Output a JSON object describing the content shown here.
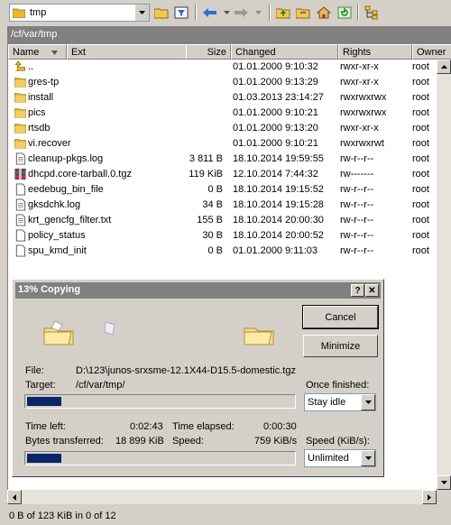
{
  "toolbar": {
    "location": "tmp"
  },
  "path": "/cf/var/tmp",
  "columns": {
    "name": "Name",
    "ext": "Ext",
    "size": "Size",
    "changed": "Changed",
    "rights": "Rights",
    "owner": "Owner"
  },
  "files": [
    {
      "name": "..",
      "size": "",
      "changed": "01.01.2000 9:10:32",
      "rights": "rwxr-xr-x",
      "owner": "root",
      "icon": "parent-dir-icon"
    },
    {
      "name": "gres-tp",
      "size": "",
      "changed": "01.01.2000 9:13:29",
      "rights": "rwxr-xr-x",
      "owner": "root",
      "icon": "folder-icon"
    },
    {
      "name": "install",
      "size": "",
      "changed": "01.03.2013 23:14:27",
      "rights": "rwxrwxrwx",
      "owner": "root",
      "icon": "folder-icon"
    },
    {
      "name": "pics",
      "size": "",
      "changed": "01.01.2000 9:10:21",
      "rights": "rwxrwxrwx",
      "owner": "root",
      "icon": "folder-icon"
    },
    {
      "name": "rtsdb",
      "size": "",
      "changed": "01.01.2000 9:13:20",
      "rights": "rwxr-xr-x",
      "owner": "root",
      "icon": "folder-icon"
    },
    {
      "name": "vi.recover",
      "size": "",
      "changed": "01.01.2000 9:10:21",
      "rights": "rwxrwxrwt",
      "owner": "root",
      "icon": "folder-icon"
    },
    {
      "name": "cleanup-pkgs.log",
      "size": "3 811 B",
      "changed": "18.10.2014 19:59:55",
      "rights": "rw-r--r--",
      "owner": "root",
      "icon": "text-file-icon"
    },
    {
      "name": "dhcpd.core-tarball.0.tgz",
      "size": "119 KiB",
      "changed": "12.10.2014 7:44:32",
      "rights": "rw-------",
      "owner": "root",
      "icon": "archive-file-icon"
    },
    {
      "name": "eedebug_bin_file",
      "size": "0 B",
      "changed": "18.10.2014 19:15:52",
      "rights": "rw-r--r--",
      "owner": "root",
      "icon": "file-icon"
    },
    {
      "name": "gksdchk.log",
      "size": "34 B",
      "changed": "18.10.2014 19:15:28",
      "rights": "rw-r--r--",
      "owner": "root",
      "icon": "text-file-icon"
    },
    {
      "name": "krt_gencfg_filter.txt",
      "size": "155 B",
      "changed": "18.10.2014 20:00:30",
      "rights": "rw-r--r--",
      "owner": "root",
      "icon": "text-file-icon"
    },
    {
      "name": "policy_status",
      "size": "30 B",
      "changed": "18.10.2014 20:00:52",
      "rights": "rw-r--r--",
      "owner": "root",
      "icon": "file-icon"
    },
    {
      "name": "spu_kmd_init",
      "size": "0 B",
      "changed": "01.01.2000 9:11:03",
      "rights": "rw-r--r--",
      "owner": "root",
      "icon": "file-icon"
    }
  ],
  "status": "0 B of 123 KiB in 0 of 12",
  "dialog": {
    "title": "13% Copying",
    "help": "?",
    "close": "✕",
    "cancel": "Cancel",
    "minimize": "Minimize",
    "file_label": "File:",
    "file_value": "D:\\123\\junos-srxsme-12.1X44-D15.5-domestic.tgz",
    "target_label": "Target:",
    "target_value": "/cf/var/tmp/",
    "once_finished_label": "Once finished:",
    "once_finished_value": "Stay idle",
    "time_left_label": "Time left:",
    "time_left_value": "0:02:43",
    "time_elapsed_label": "Time elapsed:",
    "time_elapsed_value": "0:00:30",
    "bytes_label": "Bytes transferred:",
    "bytes_value": "18 899 KiB",
    "speed_label": "Speed:",
    "speed_value": "759 KiB/s",
    "speed_limit_label": "Speed (KiB/s):",
    "speed_limit_value": "Unlimited",
    "file_progress": 0.13,
    "total_progress": 0.13
  }
}
